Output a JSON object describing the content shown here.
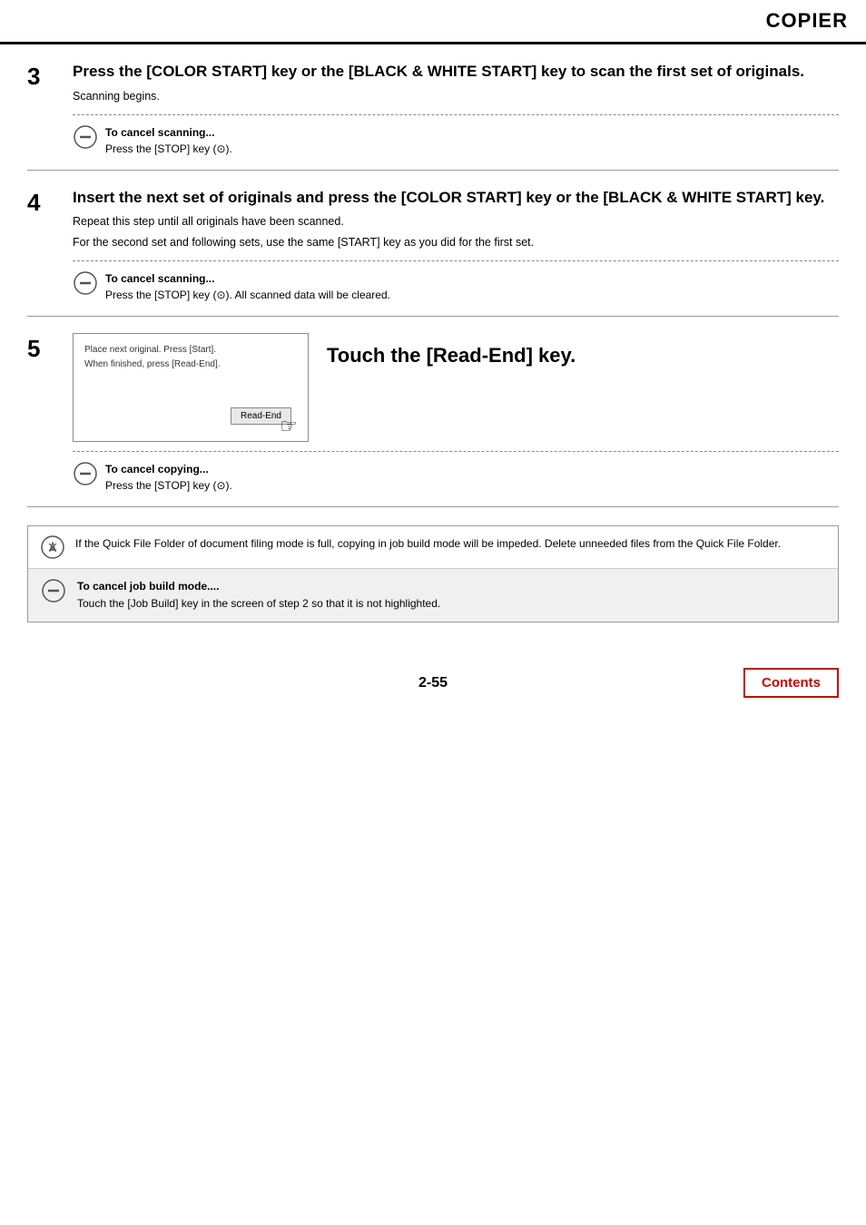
{
  "header": {
    "title": "COPIER"
  },
  "steps": [
    {
      "number": "3",
      "heading": "Press the [COLOR START] key or the [BLACK & WHITE START] key to scan the first set of originals.",
      "desc": "Scanning begins.",
      "cancel_label": "To cancel scanning...",
      "cancel_text": "Press the [STOP] key (⊙)."
    },
    {
      "number": "4",
      "heading": "Insert the next set of originals and press the [COLOR START] key or the [BLACK & WHITE START] key.",
      "desc1": "Repeat this step until all originals have been scanned.",
      "desc2": "For the second set and following sets, use the same [START] key as you did for the first set.",
      "cancel_label": "To cancel scanning...",
      "cancel_text": "Press the [STOP] key (⊙). All scanned data will be cleared."
    },
    {
      "number": "5",
      "touch_heading": "Touch the [Read-End] key.",
      "screen_line1": "Place next original. Press [Start].",
      "screen_line2": "When finished, press [Read-End].",
      "screen_btn": "Read-End",
      "cancel_label": "To cancel copying...",
      "cancel_text": "Press the [STOP] key (⊙)."
    }
  ],
  "bottom_notes": [
    {
      "type": "pencil",
      "text": "If the Quick File Folder of document filing mode is full, copying in job build mode will be impeded. Delete unneeded files from the Quick File Folder."
    },
    {
      "type": "stop",
      "bold": "To cancel job build mode....",
      "text": "Touch the [Job Build] key in the screen of step 2 so that it is not highlighted."
    }
  ],
  "footer": {
    "page_number": "2-55",
    "contents_label": "Contents"
  }
}
